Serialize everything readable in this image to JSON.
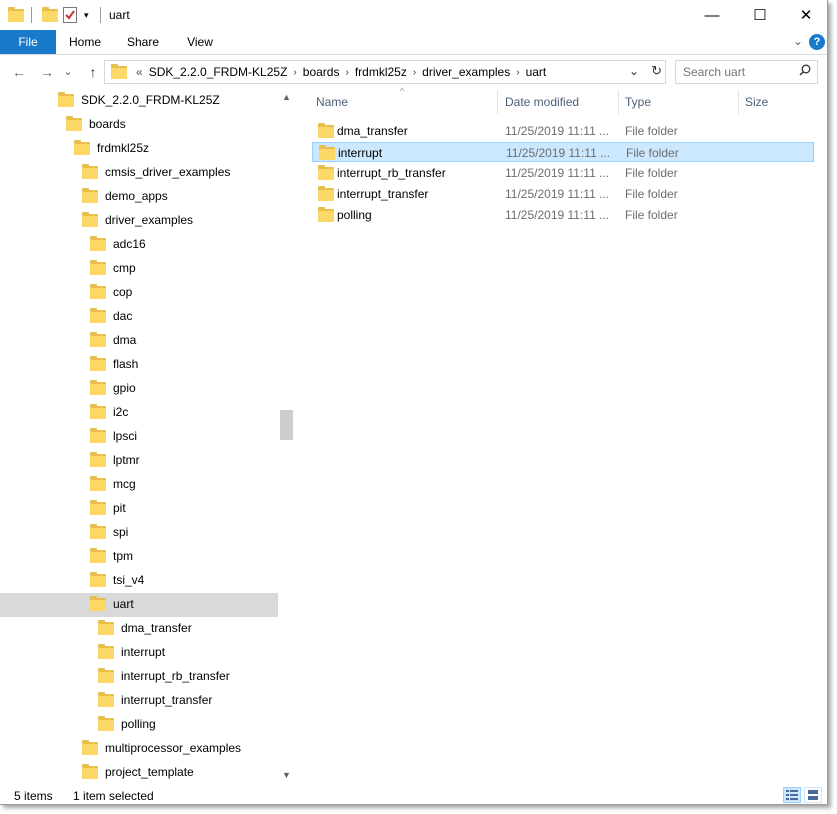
{
  "title": "uart",
  "ribbon": {
    "tabs": [
      "File",
      "Home",
      "Share",
      "View"
    ],
    "help": "?"
  },
  "window_controls": {
    "minimize": "—",
    "maximize": "☐",
    "close": "✕"
  },
  "nav": {
    "back": "←",
    "forward": "→",
    "recent": "⌄",
    "up": "↑",
    "address": [
      "«",
      "SDK_2.2.0_FRDM-KL25Z",
      "boards",
      "frdmkl25z",
      "driver_examples",
      "uart"
    ],
    "refresh": "↻",
    "search_placeholder": "Search uart"
  },
  "tree": [
    {
      "label": "SDK_2.2.0_FRDM-KL25Z"
    },
    {
      "label": "boards"
    },
    {
      "label": "frdmkl25z"
    },
    {
      "label": "cmsis_driver_examples"
    },
    {
      "label": "demo_apps"
    },
    {
      "label": "driver_examples"
    },
    {
      "label": "adc16"
    },
    {
      "label": "cmp"
    },
    {
      "label": "cop"
    },
    {
      "label": "dac"
    },
    {
      "label": "dma"
    },
    {
      "label": "flash"
    },
    {
      "label": "gpio"
    },
    {
      "label": "i2c"
    },
    {
      "label": "lpsci"
    },
    {
      "label": "lptmr"
    },
    {
      "label": "mcg"
    },
    {
      "label": "pit"
    },
    {
      "label": "spi"
    },
    {
      "label": "tpm"
    },
    {
      "label": "tsi_v4"
    },
    {
      "label": "uart",
      "selected": true
    },
    {
      "label": "dma_transfer"
    },
    {
      "label": "interrupt"
    },
    {
      "label": "interrupt_rb_transfer"
    },
    {
      "label": "interrupt_transfer"
    },
    {
      "label": "polling"
    },
    {
      "label": "multiprocessor_examples"
    },
    {
      "label": "project_template"
    }
  ],
  "columns": [
    "Name",
    "Date modified",
    "Type",
    "Size"
  ],
  "files": [
    {
      "name": "dma_transfer",
      "date": "11/25/2019 11:11 ...",
      "type": "File folder",
      "selected": false
    },
    {
      "name": "interrupt",
      "date": "11/25/2019 11:11 ...",
      "type": "File folder",
      "selected": true
    },
    {
      "name": "interrupt_rb_transfer",
      "date": "11/25/2019 11:11 ...",
      "type": "File folder",
      "selected": false
    },
    {
      "name": "interrupt_transfer",
      "date": "11/25/2019 11:11 ...",
      "type": "File folder",
      "selected": false
    },
    {
      "name": "polling",
      "date": "11/25/2019 11:11 ...",
      "type": "File folder",
      "selected": false
    }
  ],
  "status": {
    "item_count": "5 items",
    "selection": "1 item selected"
  },
  "colors": {
    "accent": "#1979ca",
    "folder": "#fcd867",
    "selection": "#cce8ff",
    "tree_selection": "#d9d9d9"
  }
}
